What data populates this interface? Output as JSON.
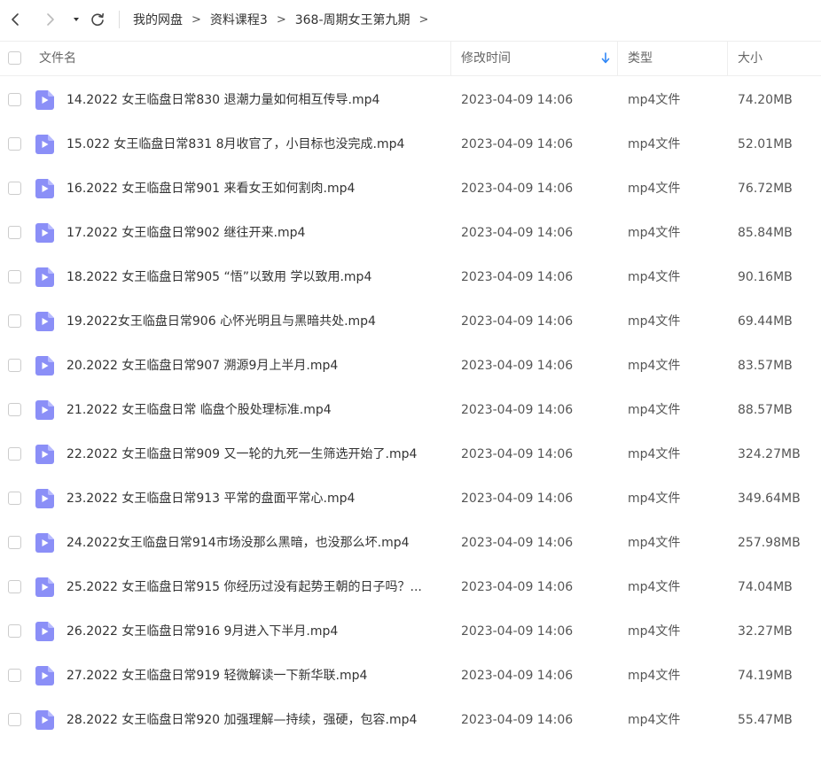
{
  "nav": {
    "back_icon": "chevron-left-icon",
    "forward_icon": "chevron-right-icon",
    "dropdown_icon": "caret-down-icon",
    "refresh_icon": "refresh-icon"
  },
  "breadcrumb": [
    "我的网盘",
    "资料课程3",
    "368-周期女王第九期"
  ],
  "breadcrumb_separator": ">",
  "columns": {
    "name": "文件名",
    "modified": "修改时间",
    "type": "类型",
    "size": "大小"
  },
  "colors": {
    "accent": "#2f86f6",
    "file_icon": "#8b8ff7"
  },
  "files": [
    {
      "name": "14.2022 女王临盘日常830 退潮力量如何相互传导.mp4",
      "modified": "2023-04-09 14:06",
      "type": "mp4文件",
      "size": "74.20MB"
    },
    {
      "name": "15.022 女王临盘日常831 8月收官了，小目标也没完成.mp4",
      "modified": "2023-04-09 14:06",
      "type": "mp4文件",
      "size": "52.01MB"
    },
    {
      "name": "16.2022 女王临盘日常901 来看女王如何割肉.mp4",
      "modified": "2023-04-09 14:06",
      "type": "mp4文件",
      "size": "76.72MB"
    },
    {
      "name": "17.2022 女王临盘日常902 继往开来.mp4",
      "modified": "2023-04-09 14:06",
      "type": "mp4文件",
      "size": "85.84MB"
    },
    {
      "name": "18.2022 女王临盘日常905 “悟”以致用 学以致用.mp4",
      "modified": "2023-04-09 14:06",
      "type": "mp4文件",
      "size": "90.16MB"
    },
    {
      "name": "19.2022女王临盘日常906 心怀光明且与黑暗共处.mp4",
      "modified": "2023-04-09 14:06",
      "type": "mp4文件",
      "size": "69.44MB"
    },
    {
      "name": "20.2022 女王临盘日常907 溯源9月上半月.mp4",
      "modified": "2023-04-09 14:06",
      "type": "mp4文件",
      "size": "83.57MB"
    },
    {
      "name": "21.2022 女王临盘日常 临盘个股处理标准.mp4",
      "modified": "2023-04-09 14:06",
      "type": "mp4文件",
      "size": "88.57MB"
    },
    {
      "name": "22.2022 女王临盘日常909 又一轮的九死一生筛选开始了.mp4",
      "modified": "2023-04-09 14:06",
      "type": "mp4文件",
      "size": "324.27MB"
    },
    {
      "name": "23.2022 女王临盘日常913 平常的盘面平常心.mp4",
      "modified": "2023-04-09 14:06",
      "type": "mp4文件",
      "size": "349.64MB"
    },
    {
      "name": "24.2022女王临盘日常914市场没那么黑暗，也没那么坏.mp4",
      "modified": "2023-04-09 14:06",
      "type": "mp4文件",
      "size": "257.98MB"
    },
    {
      "name": "25.2022 女王临盘日常915 你经历过没有起势王朝的日子吗？...",
      "modified": "2023-04-09 14:06",
      "type": "mp4文件",
      "size": "74.04MB"
    },
    {
      "name": "26.2022 女王临盘日常916 9月进入下半月.mp4",
      "modified": "2023-04-09 14:06",
      "type": "mp4文件",
      "size": "32.27MB"
    },
    {
      "name": "27.2022 女王临盘日常919 轻微解读一下新华联.mp4",
      "modified": "2023-04-09 14:06",
      "type": "mp4文件",
      "size": "74.19MB"
    },
    {
      "name": "28.2022 女王临盘日常920 加强理解—持续，强硬，包容.mp4",
      "modified": "2023-04-09 14:06",
      "type": "mp4文件",
      "size": "55.47MB"
    }
  ]
}
